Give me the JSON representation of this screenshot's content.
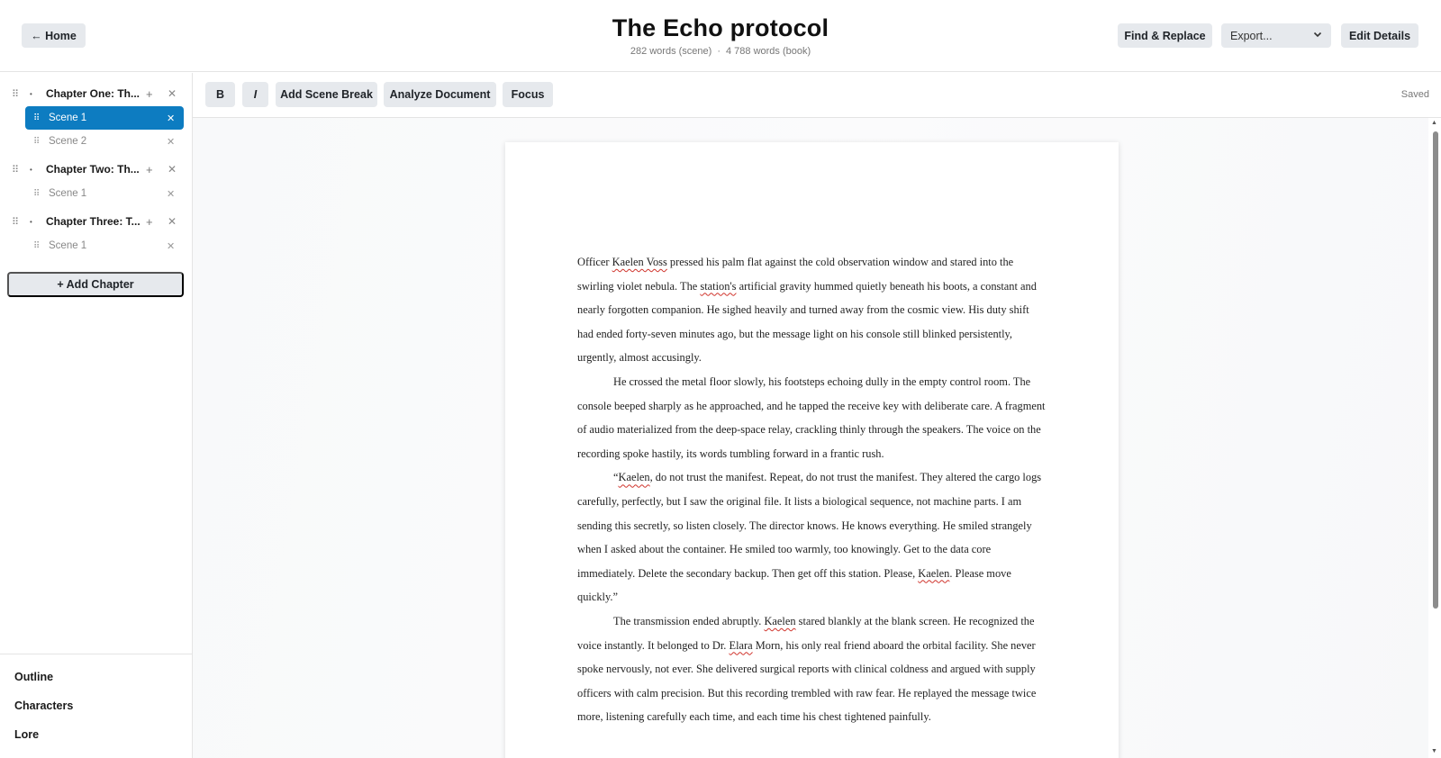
{
  "header": {
    "home_label": "← Home",
    "title": "The Echo protocol",
    "scene_words": "282 words (scene)",
    "separator": "·",
    "book_words": "4 788 words (book)",
    "find_replace_label": "Find & Replace",
    "export_selected": "Export...",
    "edit_details_label": "Edit Details"
  },
  "sidebar": {
    "chapters": [
      {
        "title": "Chapter One: Th...",
        "scenes": [
          "Scene 1",
          "Scene 2"
        ]
      },
      {
        "title": "Chapter Two: Th...",
        "scenes": [
          "Scene 1"
        ]
      },
      {
        "title": "Chapter Three: T...",
        "scenes": [
          "Scene 1"
        ]
      }
    ],
    "active_chapter": 0,
    "active_scene": 0,
    "add_chapter_label": "+ Add Chapter",
    "nav": [
      "Outline",
      "Characters",
      "Lore"
    ]
  },
  "toolbar": {
    "bold_label": "B",
    "italic_label": "I",
    "scene_break_label": "Add Scene Break",
    "analyze_label": "Analyze Document",
    "focus_label": "Focus",
    "status": "Saved"
  },
  "document": {
    "paragraphs": [
      [
        {
          "t": "Officer "
        },
        {
          "t": "Kaelen Voss",
          "s": true
        },
        {
          "t": " pressed his palm flat against the cold observation window and stared into the swirling violet nebula. The "
        },
        {
          "t": "station's",
          "s": true
        },
        {
          "t": " artificial gravity hummed quietly beneath his boots, a constant and nearly forgotten companion. He sighed heavily and turned away from the cosmic view. His duty shift had ended forty-seven minutes ago, but the message light on his console still blinked persistently, urgently, almost accusingly."
        }
      ],
      [
        {
          "t": "He crossed the metal floor slowly, his footsteps echoing dully in the empty control room. The console beeped sharply as he approached, and he tapped the receive key with deliberate care. A fragment of audio materialized from the deep-space relay, crackling thinly through the speakers. The voice on the recording spoke hastily, its words tumbling forward in a frantic rush."
        }
      ],
      [
        {
          "t": "“"
        },
        {
          "t": "Kaelen",
          "s": true
        },
        {
          "t": ", do not trust the manifest. Repeat, do not trust the manifest. They altered the cargo logs carefully, perfectly, but I saw the original file. It lists a biological sequence, not machine parts. I am sending this secretly, so listen closely. The director knows. He knows everything. He smiled strangely when I asked about the container. He smiled too warmly, too knowingly. Get to the data core immediately. Delete the secondary backup. Then get off this station. Please, "
        },
        {
          "t": "Kaelen",
          "s": true
        },
        {
          "t": ". Please move quickly.”"
        }
      ],
      [
        {
          "t": "The transmission ended abruptly. "
        },
        {
          "t": "Kaelen",
          "s": true
        },
        {
          "t": " stared blankly at the blank screen. He recognized the voice instantly. It belonged to Dr. "
        },
        {
          "t": "Elara",
          "s": true
        },
        {
          "t": " Morn, his only real friend aboard the orbital facility. She never spoke nervously, not ever. She delivered surgical reports with clinical coldness and argued with supply officers with calm precision. But this recording trembled with raw fear. He replayed the message twice more, listening carefully each time, and each time his chest tightened painfully."
        }
      ]
    ]
  },
  "colors": {
    "accent": "#0d7cc1",
    "button_bg": "#e6e9ed",
    "spellcheck": "#d0342c"
  },
  "icons": {
    "drag": "drag-handle-icon",
    "caret": "caret-icon",
    "add": "plus-icon",
    "remove": "close-icon",
    "dropdown": "chevron-down-icon"
  }
}
